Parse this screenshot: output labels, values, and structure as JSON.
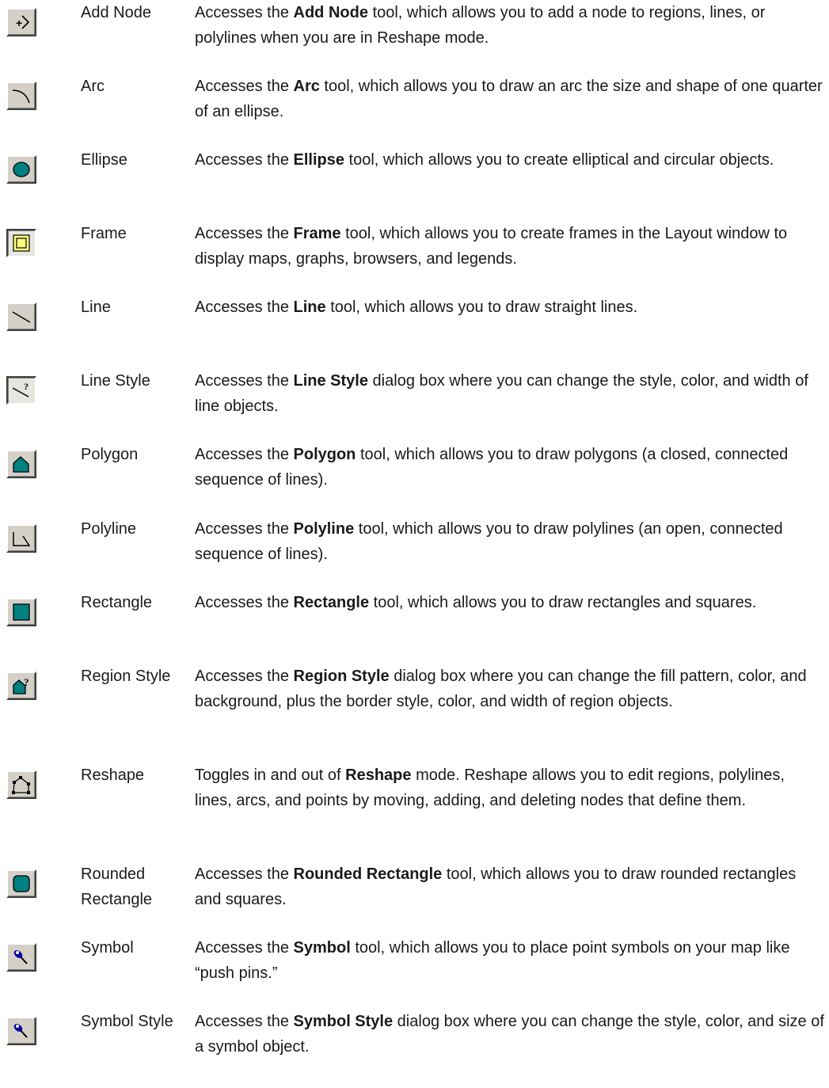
{
  "entries": [
    {
      "name": "Add Node",
      "icon": "add-node-icon",
      "pre": "Accesses the ",
      "bold": "Add Node",
      "post": " tool, which allows you to add a node to regions, lines, or polylines when you are in Reshape mode."
    },
    {
      "name": "Arc",
      "icon": "arc-icon",
      "pre": "Accesses the ",
      "bold": "Arc",
      "post": " tool, which allows you to draw an arc the size and shape of one quarter of an ellipse."
    },
    {
      "name": "Ellipse",
      "icon": "ellipse-icon",
      "pre": "Accesses the ",
      "bold": "Ellipse",
      "post": " tool, which allows you to create elliptical and circular objects."
    },
    {
      "name": "Frame",
      "icon": "frame-icon",
      "pre": "Accesses the ",
      "bold": "Frame",
      "post": " tool, which allows you to create frames in the Layout window to display maps, graphs, browsers, and legends."
    },
    {
      "name": "Line",
      "icon": "line-icon",
      "pre": "Accesses the ",
      "bold": "Line",
      "post": " tool, which allows you to draw straight lines."
    },
    {
      "name": "Line Style",
      "icon": "line-style-icon",
      "pre": "Accesses the ",
      "bold": "Line Style",
      "post": " dialog box where you can change the style, color, and width of line objects."
    },
    {
      "name": "Polygon",
      "icon": "polygon-icon",
      "pre": "Accesses the ",
      "bold": "Polygon",
      "post": " tool, which allows you to draw polygons (a closed, connected sequence of lines)."
    },
    {
      "name": "Polyline",
      "icon": "polyline-icon",
      "pre": "Accesses the ",
      "bold": "Polyline",
      "post": " tool, which allows you to draw polylines (an open, connected sequence of lines)."
    },
    {
      "name": "Rectangle",
      "icon": "rectangle-icon",
      "pre": "Accesses the ",
      "bold": "Rectangle",
      "post": " tool, which allows you to draw rectangles and squares."
    },
    {
      "name": "Region Style",
      "icon": "region-style-icon",
      "pre": "Accesses the ",
      "bold": "Region Style",
      "post": " dialog box where you can change the fill pattern, color, and background, plus the border style, color, and width of region objects."
    },
    {
      "name": "Reshape",
      "icon": "reshape-icon",
      "pre": "Toggles in and out of ",
      "bold": "Reshape",
      "post": " mode. Reshape allows you to edit regions, polylines, lines, arcs, and points by moving, adding, and deleting nodes that define them."
    },
    {
      "name": "Rounded Rectangle",
      "icon": "rounded-rectangle-icon",
      "pre": "Accesses the ",
      "bold": "Rounded Rectangle",
      "post": " tool, which allows you to draw rounded rectangles and squares."
    },
    {
      "name": "Symbol",
      "icon": "symbol-icon",
      "pre": "Accesses the ",
      "bold": "Symbol",
      "post": " tool, which allows you to place point symbols on your map like “push pins.”"
    },
    {
      "name": "Symbol Style",
      "icon": "symbol-style-icon",
      "pre": "Accesses the ",
      "bold": "Symbol Style",
      "post": " dialog box where you can change the style, color, and size of a symbol object."
    }
  ],
  "colors": {
    "button_face": "#d4d0c8",
    "teal_fill": "#008080",
    "frame_yellow": "#ffff80",
    "pin_blue": "#0000a0"
  }
}
